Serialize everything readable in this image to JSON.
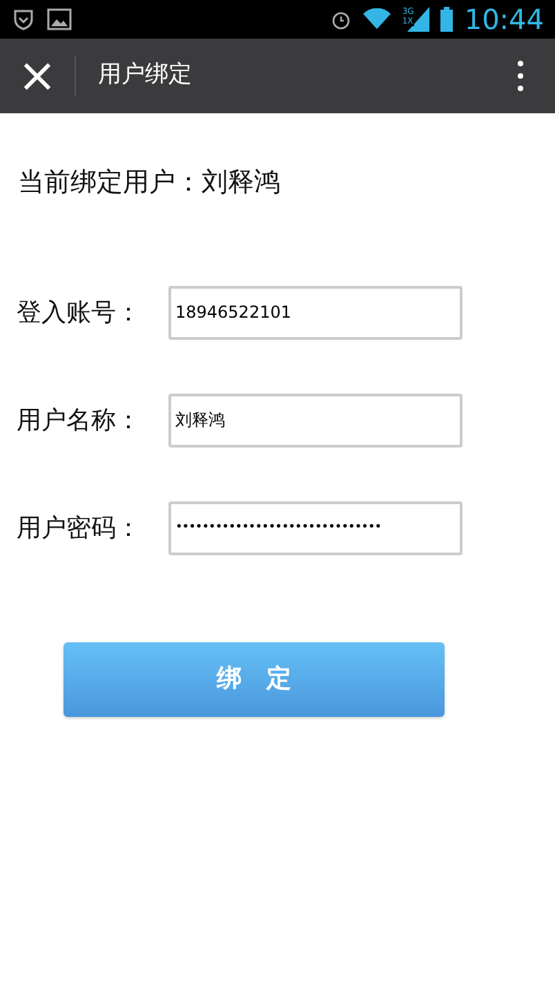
{
  "status_bar": {
    "network_labels": [
      "3G",
      "1X"
    ],
    "time": "10:44"
  },
  "app_bar": {
    "close": "×",
    "title": "用户绑定"
  },
  "current_user": "当前绑定用户：刘释鸿",
  "fields": [
    {
      "label": "登入账号：",
      "value": "18946522101"
    },
    {
      "label": "用户名称：",
      "value": "刘释鸿"
    },
    {
      "label": "用户密码：",
      "value": "•••••••••••••••••••••••••••••••"
    }
  ],
  "bind_button": "绑　定"
}
